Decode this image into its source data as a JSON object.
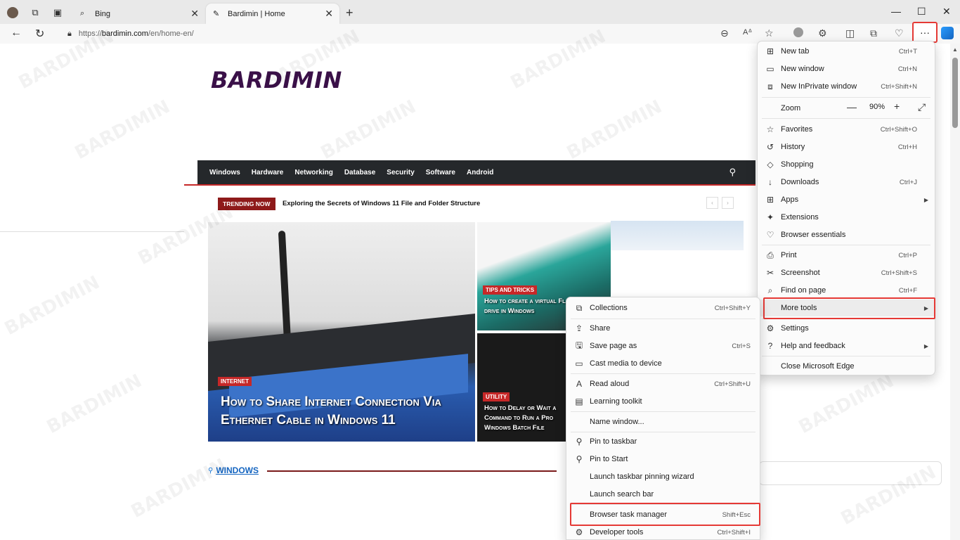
{
  "tabs": [
    {
      "label": "Bing",
      "icon": "search-icon",
      "active": false
    },
    {
      "label": "Bardimin | Home",
      "icon": "bardimin-favicon",
      "active": true
    }
  ],
  "address": {
    "protocol": "https://",
    "domain": "bardimin.com",
    "path": "/en/home-en/"
  },
  "site": {
    "logo_text": "BARDIMIN",
    "nav": [
      "Windows",
      "Hardware",
      "Networking",
      "Database",
      "Security",
      "Software",
      "Android"
    ],
    "trending_badge": "TRENDING NOW",
    "trending_text": "Exploring the Secrets of Windows 11 File and Folder Structure",
    "hero": {
      "category": "INTERNET",
      "title": "How to Share Internet Connection Via Ethernet Cable in Windows 11"
    },
    "card1": {
      "category": "TIPS AND TRICKS",
      "title": "How to create a virtual Flash drive in Windows"
    },
    "card2": {
      "category": "UTILITY",
      "title": "How to Delay or Wait a Command to Run a Pro Windows Batch File"
    },
    "section": "WINDOWS",
    "watermark": "BARDIMIN"
  },
  "main_menu": {
    "new_tab": {
      "label": "New tab",
      "shortcut": "Ctrl+T"
    },
    "new_window": {
      "label": "New window",
      "shortcut": "Ctrl+N"
    },
    "new_inprivate": {
      "label": "New InPrivate window",
      "shortcut": "Ctrl+Shift+N"
    },
    "zoom": {
      "label": "Zoom",
      "value": "90%",
      "minus": "—",
      "plus": "+"
    },
    "favorites": {
      "label": "Favorites",
      "shortcut": "Ctrl+Shift+O"
    },
    "history": {
      "label": "History",
      "shortcut": "Ctrl+H"
    },
    "shopping": {
      "label": "Shopping"
    },
    "downloads": {
      "label": "Downloads",
      "shortcut": "Ctrl+J"
    },
    "apps": {
      "label": "Apps"
    },
    "extensions": {
      "label": "Extensions"
    },
    "essentials": {
      "label": "Browser essentials"
    },
    "print": {
      "label": "Print",
      "shortcut": "Ctrl+P"
    },
    "screenshot": {
      "label": "Screenshot",
      "shortcut": "Ctrl+Shift+S"
    },
    "find": {
      "label": "Find on page",
      "shortcut": "Ctrl+F"
    },
    "more_tools": {
      "label": "More tools"
    },
    "settings": {
      "label": "Settings"
    },
    "help": {
      "label": "Help and feedback"
    },
    "close": {
      "label": "Close Microsoft Edge"
    }
  },
  "sub_menu": {
    "collections": {
      "label": "Collections",
      "shortcut": "Ctrl+Shift+Y"
    },
    "share": {
      "label": "Share"
    },
    "save_page": {
      "label": "Save page as",
      "shortcut": "Ctrl+S"
    },
    "cast": {
      "label": "Cast media to device"
    },
    "read_aloud": {
      "label": "Read aloud",
      "shortcut": "Ctrl+Shift+U"
    },
    "learning": {
      "label": "Learning toolkit"
    },
    "name_window": {
      "label": "Name window..."
    },
    "pin_taskbar": {
      "label": "Pin to taskbar"
    },
    "pin_start": {
      "label": "Pin to Start"
    },
    "pin_wizard": {
      "label": "Launch taskbar pinning wizard"
    },
    "search_bar": {
      "label": "Launch search bar"
    },
    "task_manager": {
      "label": "Browser task manager",
      "shortcut": "Shift+Esc"
    },
    "dev_tools": {
      "label": "Developer tools",
      "shortcut": "Ctrl+Shift+I"
    }
  },
  "colors": {
    "highlight": "#e53935",
    "navbar": "#25282b",
    "accent_red": "#c62828",
    "logo": "#3a1048"
  }
}
